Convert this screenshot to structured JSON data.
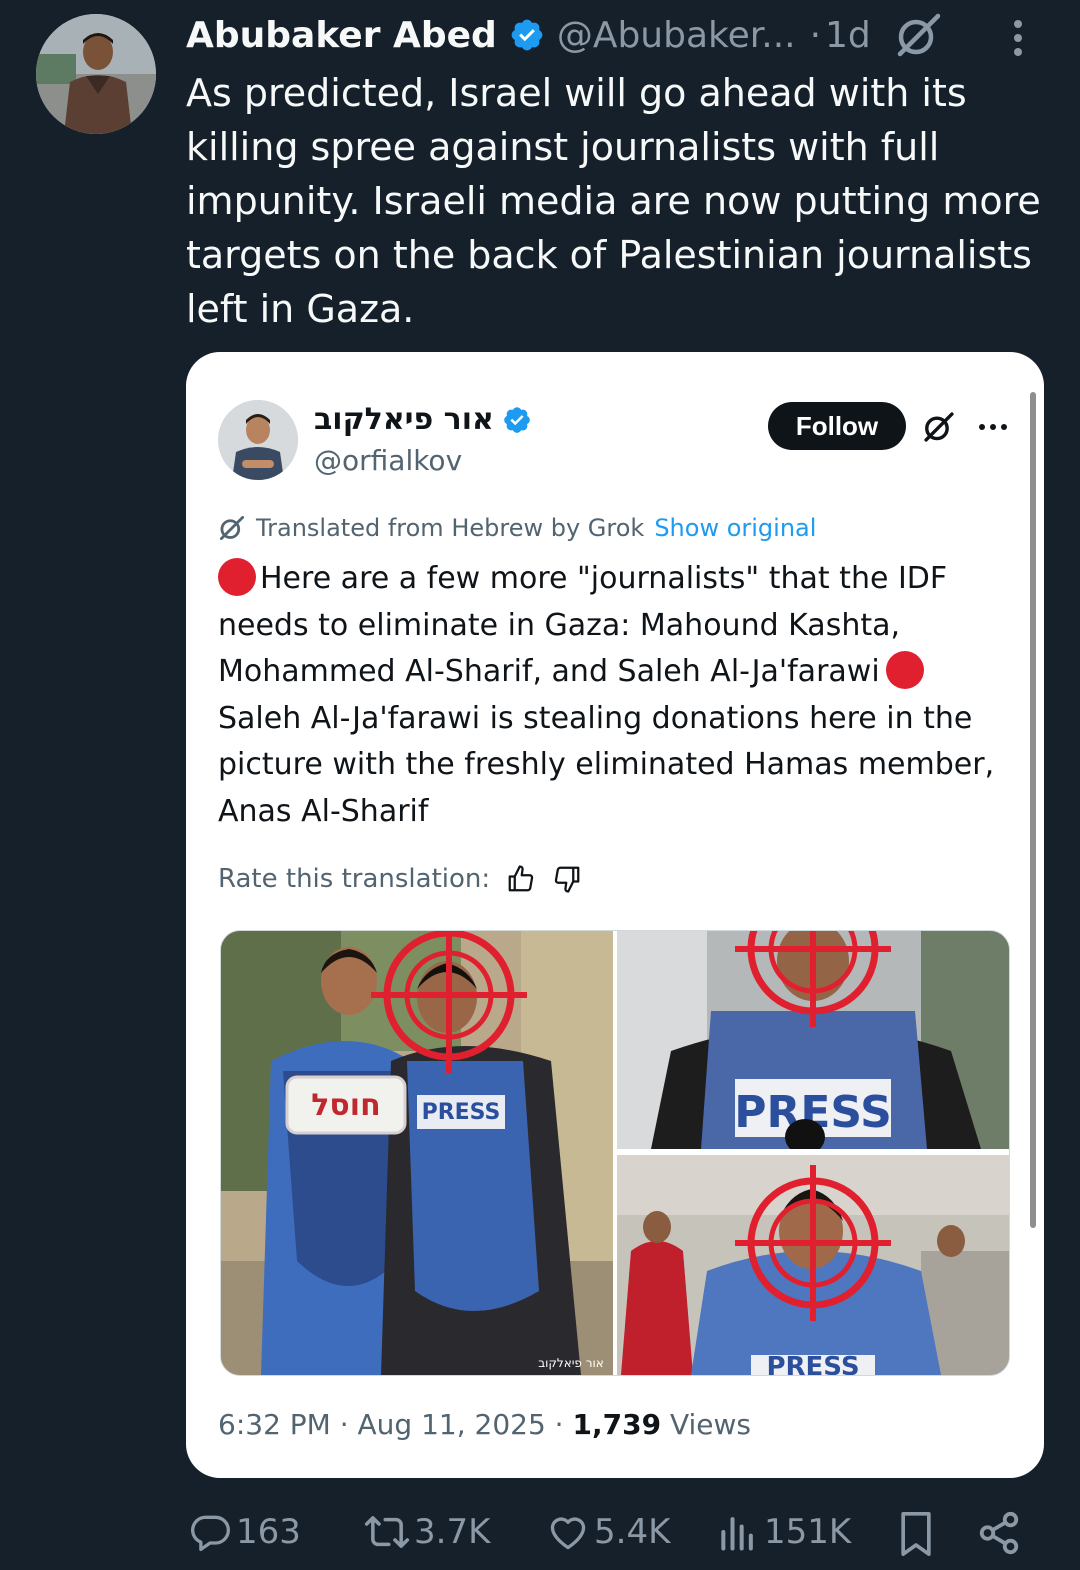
{
  "tweet": {
    "author_name": "Abubaker Abed",
    "author_handle": "@Abubaker...",
    "separator": "·",
    "time_ago": "1d",
    "text": "As predicted, Israel will go ahead with its killing spree against journalists with full impunity. Israeli media are now putting more targets on the back of Palestinian journalists left in Gaza."
  },
  "quoted": {
    "author_name": "אור פיאלקוב",
    "author_handle": "@orfialkov",
    "follow_label": "Follow",
    "translated_label": "Translated from Hebrew by Grok",
    "show_original_label": "Show original",
    "text_part1": "Here are a few more \"journalists\" that the IDF needs to eliminate in Gaza: Mahound Kashta, Mohammed Al-Sharif, and Saleh Al-Ja'farawi",
    "text_part2": "Saleh Al-Ja'farawi is stealing donations here in the picture with the freshly eliminated Hamas member, Anas Al-Sharif",
    "rate_label": "Rate this translation:",
    "image_text": {
      "hebrew_tag": "חוסל",
      "press_1": "PRESS",
      "press_2": "PRESS",
      "press_3": "PRESS",
      "watermark": "אור פיאלקוב"
    },
    "timestamp": "6:32 PM · Aug 11, 2025 ·",
    "views_count": "1,739",
    "views_label": "Views"
  },
  "actions": {
    "replies": "163",
    "reposts": "3.7K",
    "likes": "5.4K",
    "views": "151K"
  },
  "colors": {
    "background": "#15202b",
    "verified": "#1d9bf0",
    "link": "#1d9bf0",
    "target_red": "#e0202e"
  },
  "icons": [
    "verified-badge-icon",
    "grok-icon",
    "more-vertical-icon",
    "more-horizontal-icon",
    "thumbs-up-icon",
    "thumbs-down-icon",
    "reply-icon",
    "repost-icon",
    "like-icon",
    "views-icon",
    "bookmark-icon",
    "share-icon"
  ]
}
